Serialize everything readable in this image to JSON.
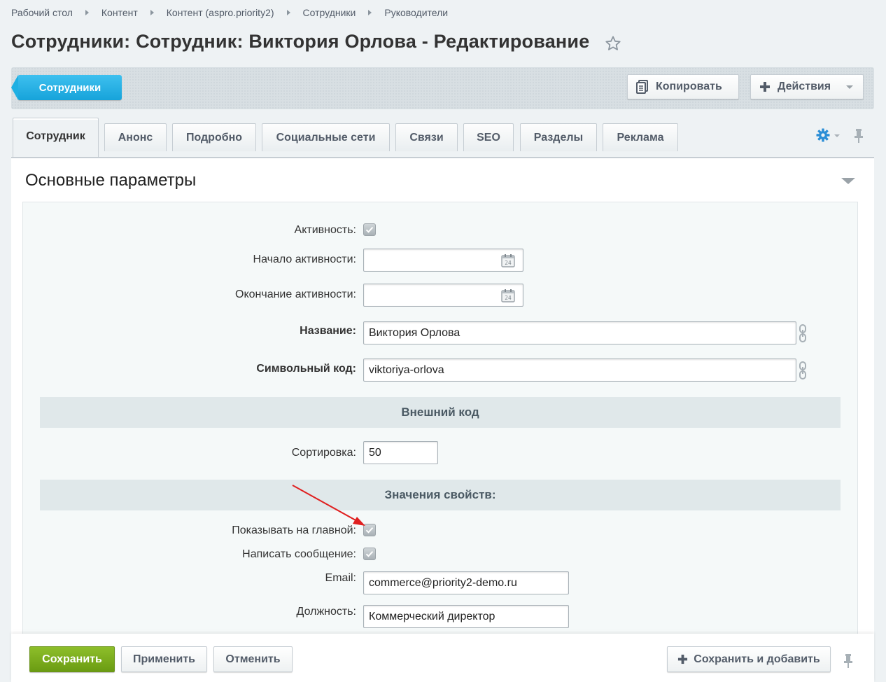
{
  "breadcrumbs": [
    "Рабочий стол",
    "Контент",
    "Контент (aspro.priority2)",
    "Сотрудники",
    "Руководители"
  ],
  "page_title": "Сотрудники: Сотрудник: Виктория Орлова - Редактирование",
  "toolbar": {
    "back_label": "Сотрудники",
    "copy_label": "Копировать",
    "actions_label": "Действия"
  },
  "tabs": [
    "Сотрудник",
    "Анонс",
    "Подробно",
    "Социальные сети",
    "Связи",
    "SEO",
    "Разделы",
    "Реклама"
  ],
  "active_tab": "Сотрудник",
  "section": {
    "title": "Основные параметры"
  },
  "fields": {
    "active_label": "Активность:",
    "active_checked": true,
    "active_from_label": "Начало активности:",
    "active_from_value": "",
    "active_to_label": "Окончание активности:",
    "active_to_value": "",
    "name_label": "Название:",
    "name_value": "Виктория Орлова",
    "code_label": "Символьный код:",
    "code_value": "viktoriya-orlova",
    "external_code_header": "Внешний код",
    "sort_label": "Сортировка:",
    "sort_value": "50",
    "properties_header": "Значения свойств:",
    "show_main_label": "Показывать на главной:",
    "show_main_checked": true,
    "write_msg_label": "Написать сообщение:",
    "write_msg_checked": true,
    "email_label": "Email:",
    "email_value": "commerce@priority2-demo.ru",
    "position_label": "Должность:",
    "position_value": "Коммерческий директор"
  },
  "footer": {
    "save_label": "Сохранить",
    "apply_label": "Применить",
    "cancel_label": "Отменить",
    "save_add_label": "Сохранить и добавить"
  },
  "colors": {
    "accent": "#16a3da",
    "save_green": "#7bad1d",
    "annotation_arrow": "#e02020"
  },
  "icons": [
    "star-icon",
    "copy-icon",
    "plus-icon",
    "gear-icon",
    "pin-icon",
    "calendar-icon",
    "link-icon",
    "check-icon"
  ]
}
